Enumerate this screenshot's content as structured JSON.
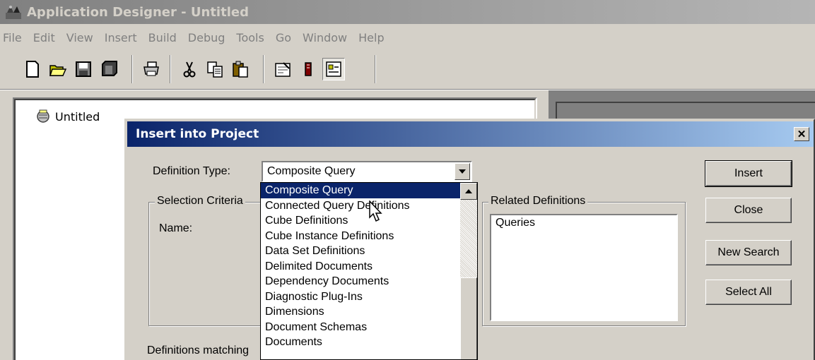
{
  "window": {
    "title": "Application Designer - Untitled"
  },
  "menu": [
    "File",
    "Edit",
    "View",
    "Insert",
    "Build",
    "Debug",
    "Tools",
    "Go",
    "Window",
    "Help"
  ],
  "toolbar": {
    "icons": [
      "new-icon",
      "open-icon",
      "save-icon",
      "save-all-icon",
      "print-icon",
      "cut-icon",
      "copy-icon",
      "paste-icon",
      "properties-icon",
      "compare-icon",
      "project-icon"
    ]
  },
  "project": {
    "root_label": "Untitled"
  },
  "dialog": {
    "title": "Insert into Project",
    "definition_type_label": "Definition Type:",
    "definition_type_value": "Composite Query",
    "selection_criteria_label": "Selection Criteria",
    "name_label": "Name:",
    "related_definitions_label": "Related Definitions",
    "related_definitions_items": [
      "Queries"
    ],
    "definitions_matching_label": "Definitions matching",
    "buttons": {
      "insert": "Insert",
      "close": "Close",
      "new_search": "New Search",
      "select_all": "Select All"
    },
    "dropdown_items": [
      "Composite Query",
      "Connected Query Definitions",
      "Cube Definitions",
      "Cube Instance Definitions",
      "Data Set Definitions",
      "Delimited Documents",
      "Dependency Documents",
      "Diagnostic Plug-Ins",
      "Dimensions",
      "Document Schemas",
      "Documents"
    ],
    "selected_index": 0
  }
}
